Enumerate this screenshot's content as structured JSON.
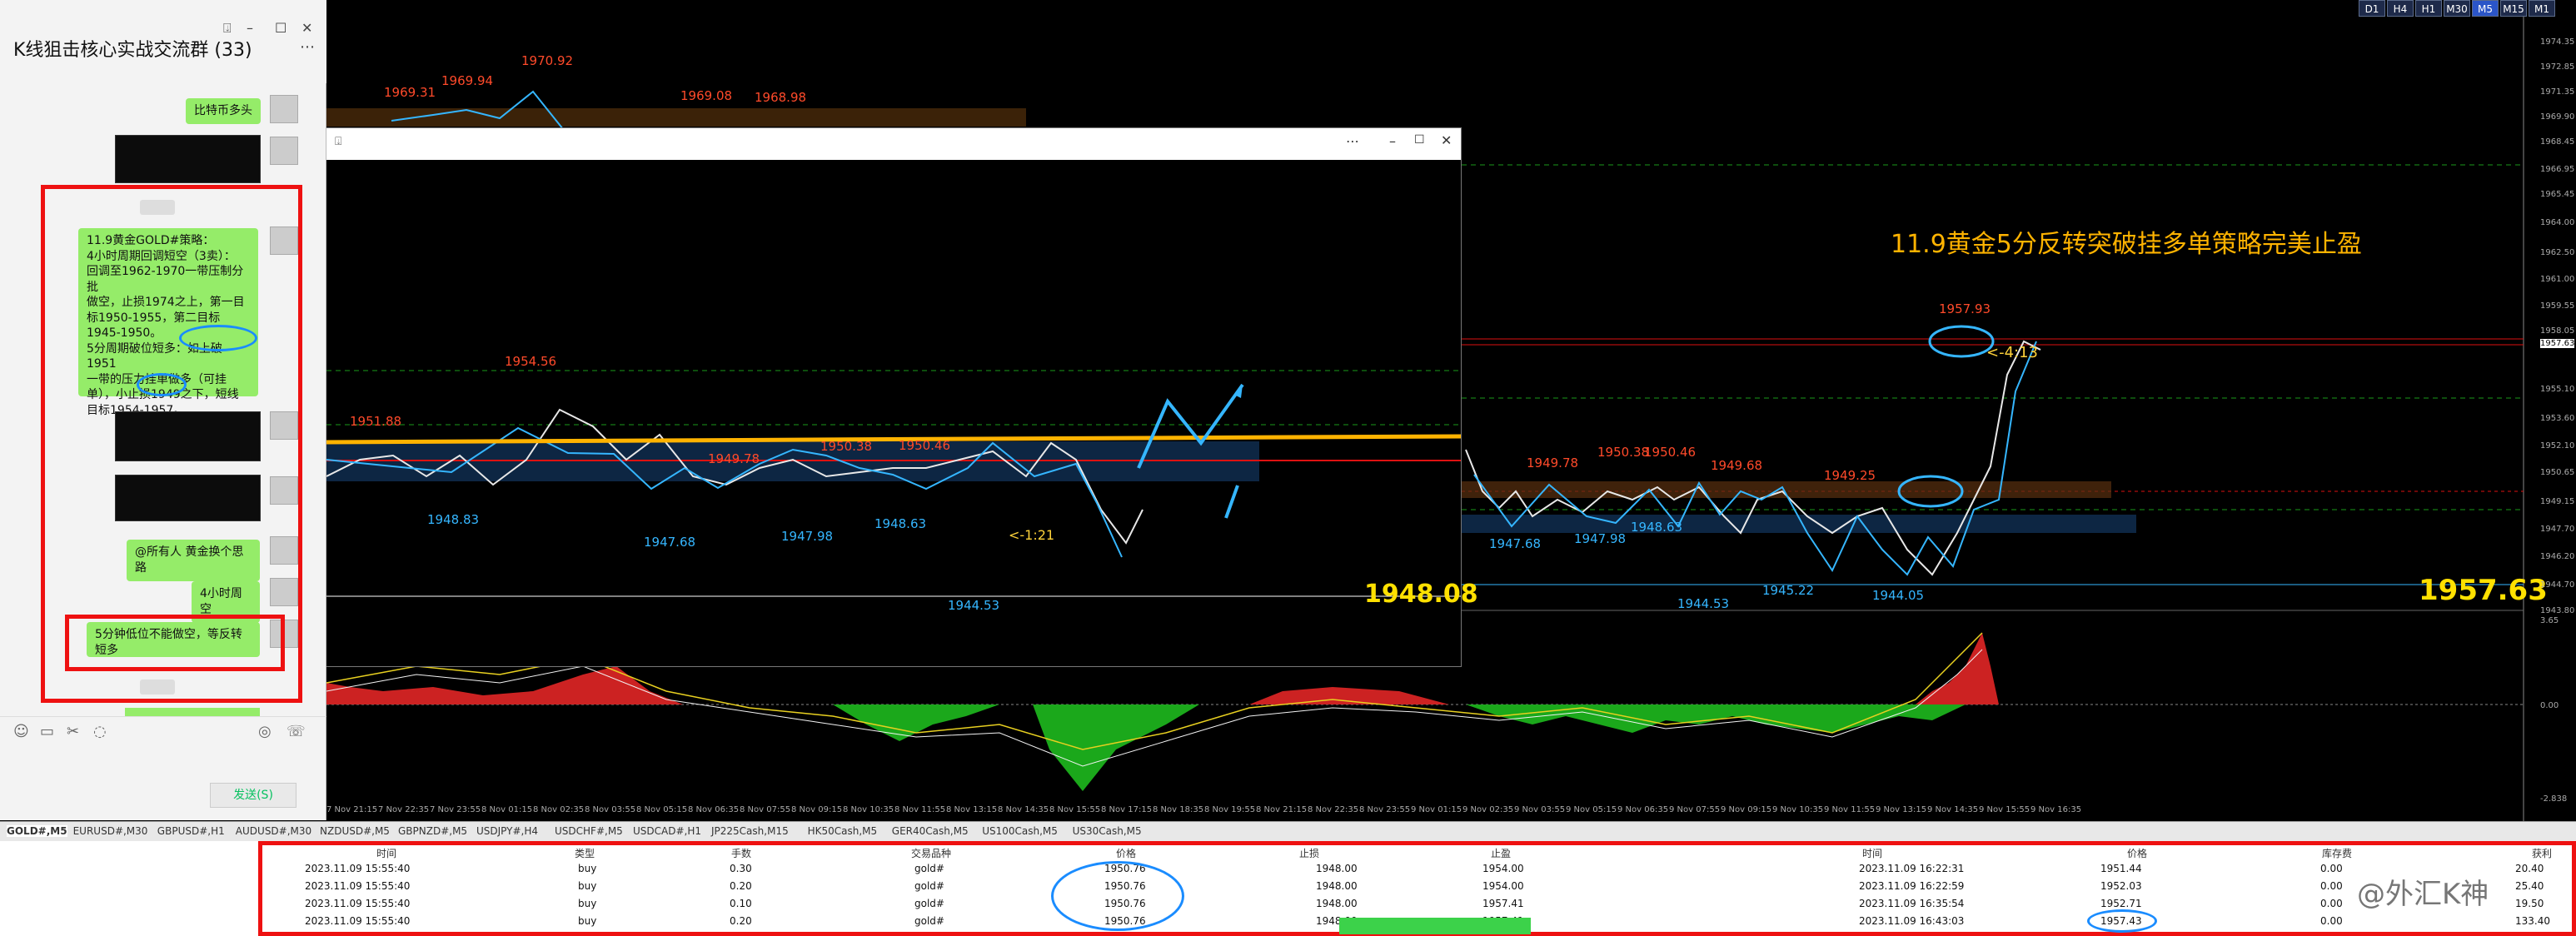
{
  "chat": {
    "title": "K线狙击核心实战交流群 (33)",
    "messages": {
      "m1": "比特币多头",
      "m2_lines": [
        "11.9黄金GOLD#策略：",
        "4小时周期回调短空（3卖）：",
        "回调至1962-1970一带压制分批",
        "做空，止损1974之上，第一目",
        "标1950-1955，第二目标",
        "1945-1950。",
        "5分周期破位短多：如上破1951",
        "一带的压力挂单做多（可挂",
        "单），小止损1949之下，短线",
        "目标1954-1957。"
      ],
      "m3": "@所有人 黄金换个思路",
      "m4": "4小时周空",
      "m5": "5分钟低位不能做空，等反转短多"
    },
    "send_label": "发送(S)"
  },
  "timeframes": [
    "D1",
    "H4",
    "H1",
    "M30",
    "M5",
    "M15",
    "M1"
  ],
  "active_tf": "M5",
  "chart": {
    "headline": "11.9黄金5分反转突破挂多单策略完美止盈",
    "price_left": "1948.08",
    "price_right": "1957.63",
    "countdown_main": "<-4:13",
    "countdown_sub": "<-1:21",
    "top_labels": [
      "1969.31",
      "1969.94",
      "1970.92",
      "1969.08",
      "1968.98"
    ],
    "sub_red": [
      "1951.88",
      "1954.56",
      "1949.78",
      "1950.38",
      "1950.46"
    ],
    "sub_blue": [
      "1948.83",
      "1947.68",
      "1947.98",
      "1948.63",
      "1944.53"
    ],
    "main_red": [
      "1949.78",
      "1950.38",
      "1950.46",
      "1949.68",
      "1949.25",
      "1957.93"
    ],
    "main_blue": [
      "1947.68",
      "1947.98",
      "1948.63",
      "1944.53",
      "1945.22",
      "1944.05"
    ],
    "yaxis": [
      "1974.35",
      "1972.85",
      "1971.35",
      "1969.90",
      "1968.45",
      "1966.95",
      "1965.45",
      "1964.00",
      "1962.50",
      "1961.00",
      "1959.55",
      "1958.05",
      "1957.63",
      "1955.10",
      "1953.60",
      "1952.10",
      "1950.65",
      "1949.15",
      "1947.70",
      "1946.20",
      "1944.70",
      "1943.80",
      "3.65",
      "0.00",
      "-2.838"
    ],
    "xaxis": [
      "7 Nov 21:15",
      "7 Nov 22:35",
      "7 Nov 23:55",
      "8 Nov 01:15",
      "8 Nov 02:35",
      "8 Nov 03:55",
      "8 Nov 05:15",
      "8 Nov 06:35",
      "8 Nov 07:55",
      "8 Nov 09:15",
      "8 Nov 10:35",
      "8 Nov 11:55",
      "8 Nov 13:15",
      "8 Nov 14:35",
      "8 Nov 15:55",
      "8 Nov 17:15",
      "8 Nov 18:35",
      "8 Nov 19:55",
      "8 Nov 21:15",
      "8 Nov 22:35",
      "8 Nov 23:55",
      "9 Nov 01:15",
      "9 Nov 02:35",
      "9 Nov 03:55",
      "9 Nov 05:15",
      "9 Nov 06:35",
      "9 Nov 07:55",
      "9 Nov 09:15",
      "9 Nov 10:35",
      "9 Nov 11:55",
      "9 Nov 13:15",
      "9 Nov 14:35",
      "9 Nov 15:55",
      "9 Nov 16:35"
    ]
  },
  "tabs": [
    "GOLD#,M5",
    "EURUSD#,M30",
    "GBPUSD#,H1",
    "AUDUSD#,M30",
    "NZDUSD#,M5",
    "GBPNZD#,M5",
    "USDJPY#,H4",
    "USDCHF#,M5",
    "USDCAD#,H1",
    "JP225Cash,M15",
    "HK50Cash,M5",
    "GER40Cash,M5",
    "US100Cash,M5",
    "US30Cash,M5"
  ],
  "table": {
    "headers": [
      "时间",
      "类型",
      "手数",
      "交易品种",
      "价格",
      "止损",
      "止盈",
      "时间",
      "价格",
      "库存费",
      "获利"
    ],
    "rows": [
      [
        "2023.11.09 15:55:40",
        "buy",
        "0.30",
        "gold#",
        "1950.76",
        "1948.00",
        "1954.00",
        "2023.11.09 16:22:31",
        "1951.44",
        "0.00",
        "20.40"
      ],
      [
        "2023.11.09 15:55:40",
        "buy",
        "0.20",
        "gold#",
        "1950.76",
        "1948.00",
        "1954.00",
        "2023.11.09 16:22:59",
        "1952.03",
        "0.00",
        "25.40"
      ],
      [
        "2023.11.09 15:55:40",
        "buy",
        "0.10",
        "gold#",
        "1950.76",
        "1948.00",
        "1957.41",
        "2023.11.09 16:35:54",
        "1952.71",
        "0.00",
        "19.50"
      ],
      [
        "2023.11.09 15:55:40",
        "buy",
        "0.20",
        "gold#",
        "1950.76",
        "1948.00",
        "1957.41",
        "2023.11.09 16:43:03",
        "1957.43",
        "0.00",
        "133.40"
      ]
    ]
  },
  "watermark": "@外汇K神"
}
